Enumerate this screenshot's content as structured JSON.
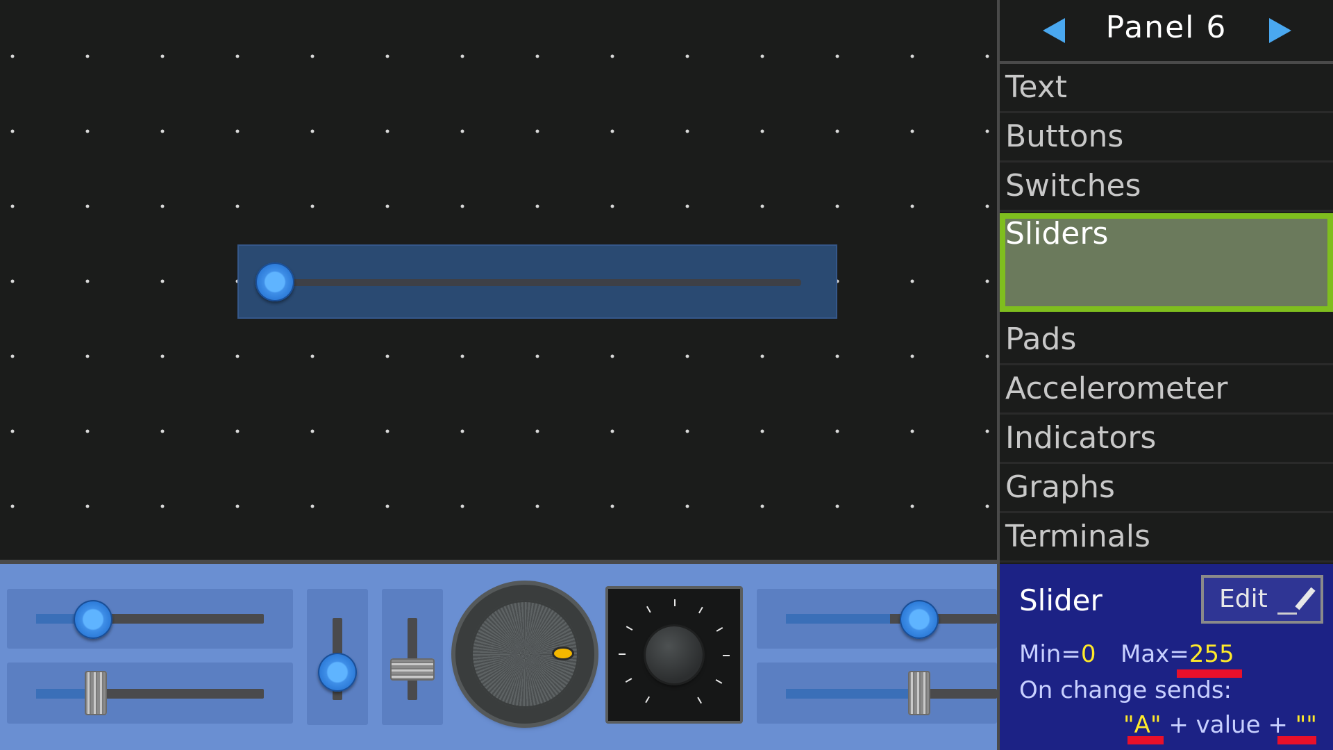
{
  "panel": {
    "title": "Panel 6",
    "menu": [
      "Text",
      "Buttons",
      "Switches",
      "Sliders",
      "Pads",
      "Accelerometer",
      "Indicators",
      "Graphs",
      "Terminals"
    ],
    "selected": "Sliders"
  },
  "properties": {
    "title": "Slider",
    "edit_label": "Edit",
    "min_label": "Min=",
    "min_value": "0",
    "max_label": "Max=",
    "max_value": "255",
    "on_change_label": "On change sends:",
    "prefix": "\"A\"",
    "middle": " + value + ",
    "suffix": "\"\""
  },
  "colors": {
    "accent": "#4aa8f0",
    "selected_border": "#7fbe1e",
    "properties_bg": "#1c2285",
    "toolbar_bg": "#6a8fd2"
  },
  "placed_slider": {
    "value": 0
  },
  "toolbar_items": [
    "horizontal-slider-round",
    "horizontal-slider-grip",
    "vertical-slider-round",
    "vertical-slider-grip",
    "dial",
    "knob",
    "horizontal-slider-round-right",
    "horizontal-slider-grip-right"
  ]
}
